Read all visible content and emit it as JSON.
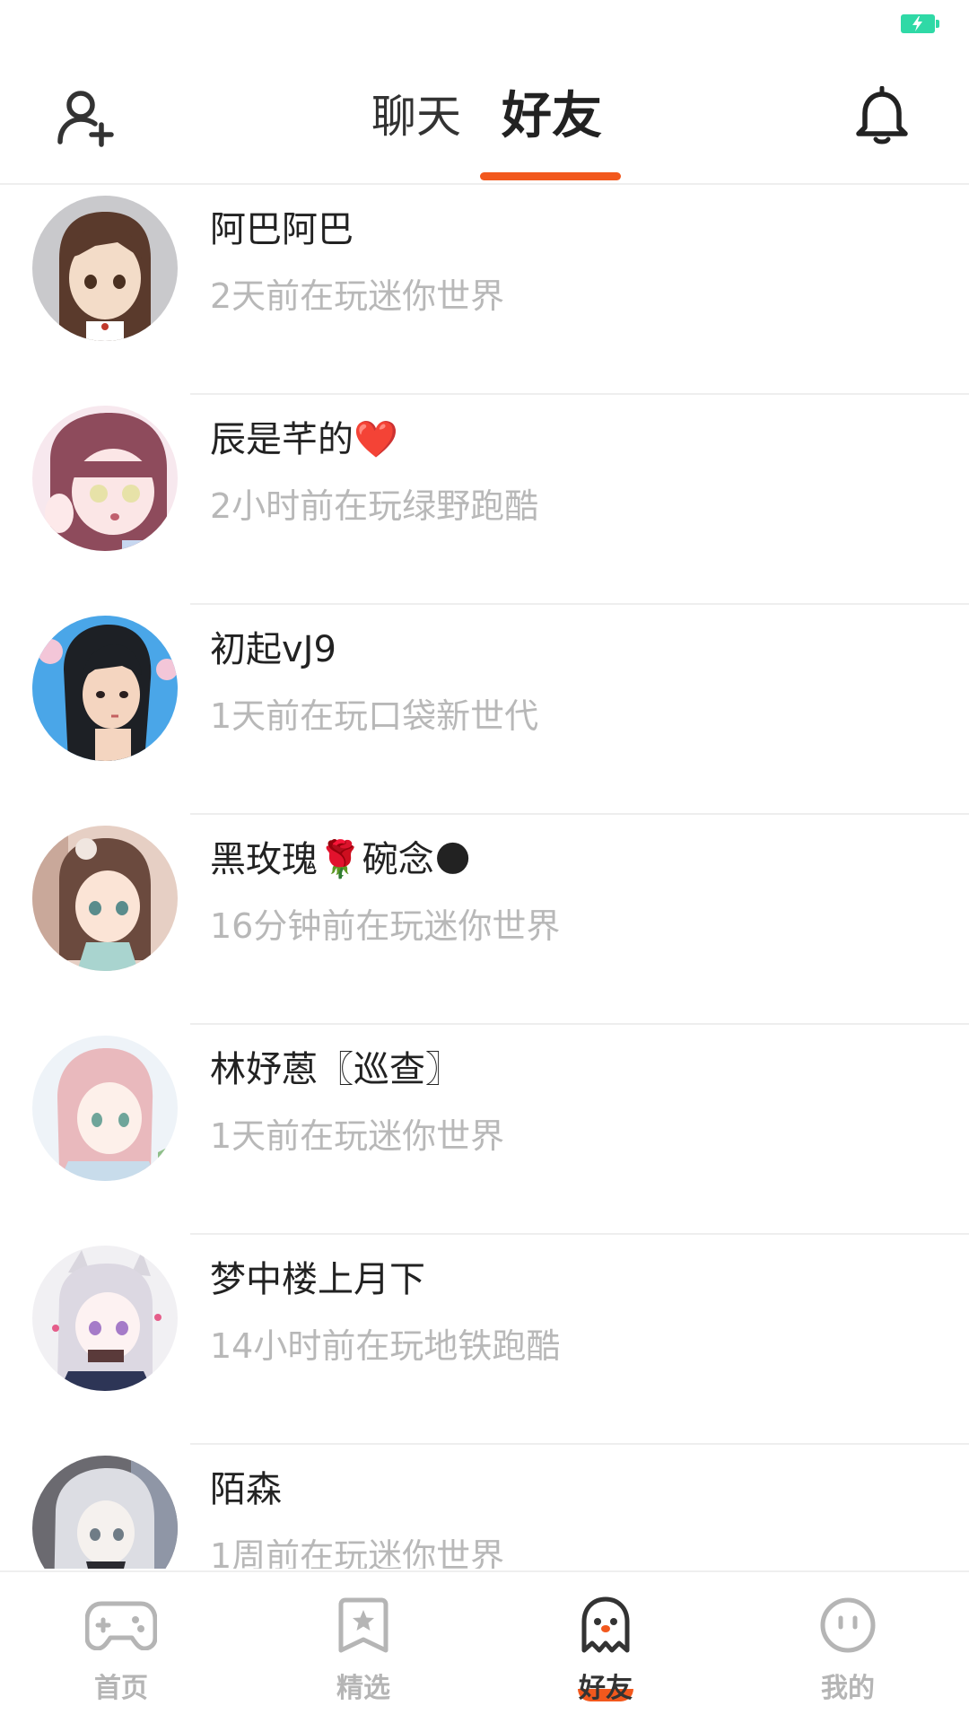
{
  "status_bar": {
    "battery_color": "#2fd9a6",
    "icon": "charging-bolt-icon"
  },
  "header": {
    "add_friend_icon": "add-user-icon",
    "tabs": [
      {
        "label": "聊天",
        "active": false
      },
      {
        "label": "好友",
        "active": true
      }
    ],
    "notification_icon": "bell-icon",
    "accent_color": "#f2581d"
  },
  "friends": [
    {
      "name": "阿巴阿巴",
      "status": "2天前在玩迷你世界"
    },
    {
      "name": "辰是芊的❤️",
      "status": "2小时前在玩绿野跑酷"
    },
    {
      "name": "初起vJ9",
      "status": "1天前在玩口袋新世代"
    },
    {
      "name": "黑玫瑰🌹碗念🌑",
      "status": "16分钟前在玩迷你世界"
    },
    {
      "name": "林妤蒽〖巡查〗",
      "status": "1天前在玩迷你世界"
    },
    {
      "name": "梦中楼上月下",
      "status": "14小时前在玩地铁跑酷"
    },
    {
      "name": "陌森",
      "status": "1周前在玩迷你世界"
    }
  ],
  "bottom_nav": {
    "items": [
      {
        "label": "首页",
        "icon": "gamepad-icon",
        "active": false
      },
      {
        "label": "精选",
        "icon": "star-bookmark-icon",
        "active": false
      },
      {
        "label": "好友",
        "icon": "ghost-icon",
        "active": true
      },
      {
        "label": "我的",
        "icon": "face-icon",
        "active": false
      }
    ]
  }
}
